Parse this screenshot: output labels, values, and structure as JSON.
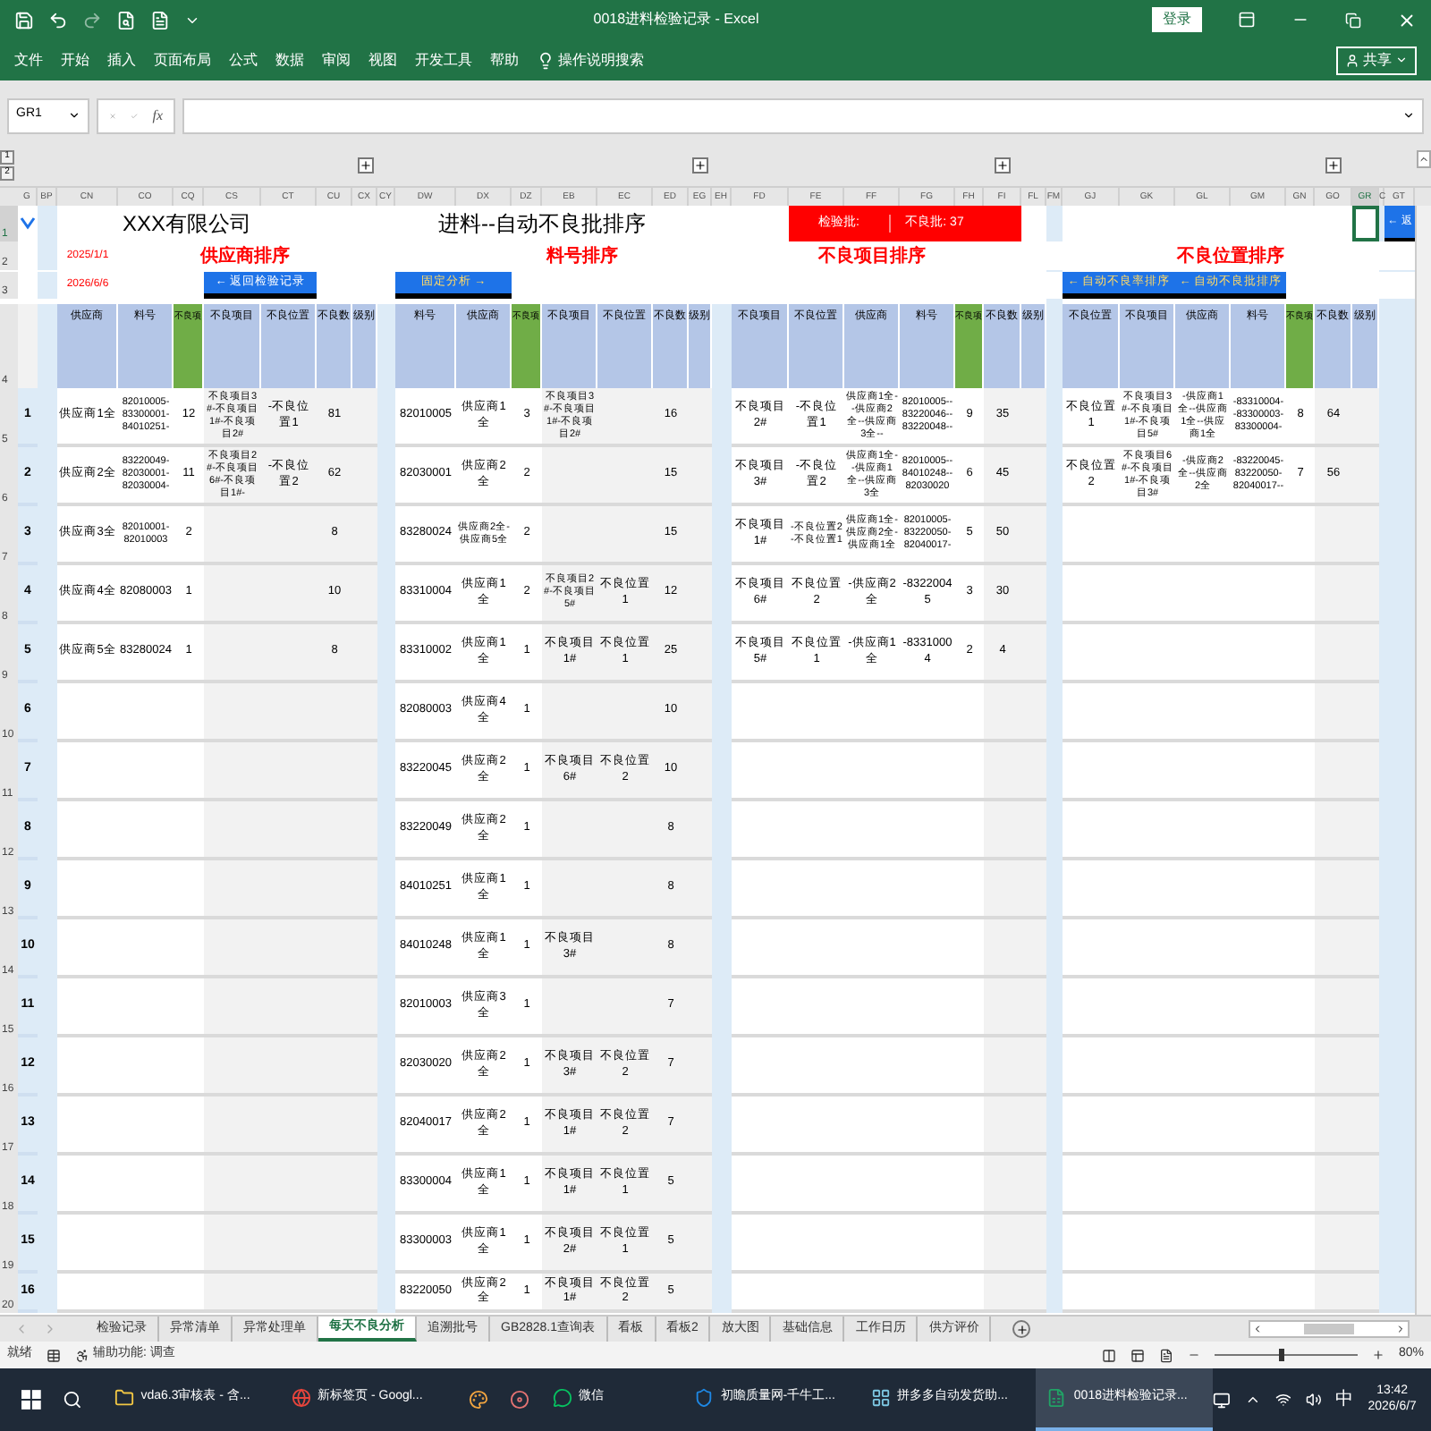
{
  "window": {
    "title": "0018进料检验记录 - Excel",
    "login_button": "登录"
  },
  "ribbon_tabs": [
    "文件",
    "开始",
    "插入",
    "页面布局",
    "公式",
    "数据",
    "审阅",
    "视图",
    "开发工具",
    "帮助"
  ],
  "tell_me": "操作说明搜索",
  "share_button": "共享",
  "name_box": "GR1",
  "function_label": "fx",
  "outline_levels": [
    "1",
    "2"
  ],
  "column_headers": [
    {
      "label": "G",
      "selected": false
    },
    {
      "label": "BP",
      "selected": false
    },
    {
      "label": "CN",
      "selected": false
    },
    {
      "label": "CO",
      "selected": false
    },
    {
      "label": "CQ",
      "selected": false
    },
    {
      "label": "CS",
      "selected": false
    },
    {
      "label": "CT",
      "selected": false
    },
    {
      "label": "CU",
      "selected": false
    },
    {
      "label": "CX",
      "selected": false
    },
    {
      "label": "CY",
      "selected": false
    },
    {
      "label": "DW",
      "selected": false
    },
    {
      "label": "DX",
      "selected": false
    },
    {
      "label": "DZ",
      "selected": false
    },
    {
      "label": "EB",
      "selected": false
    },
    {
      "label": "EC",
      "selected": false
    },
    {
      "label": "ED",
      "selected": false
    },
    {
      "label": "EG",
      "selected": false
    },
    {
      "label": "EH",
      "selected": false
    },
    {
      "label": "FD",
      "selected": false
    },
    {
      "label": "FE",
      "selected": false
    },
    {
      "label": "FF",
      "selected": false
    },
    {
      "label": "FG",
      "selected": false
    },
    {
      "label": "FH",
      "selected": false
    },
    {
      "label": "FI",
      "selected": false
    },
    {
      "label": "FL",
      "selected": false
    },
    {
      "label": "FM",
      "selected": false
    },
    {
      "label": "GJ",
      "selected": false
    },
    {
      "label": "GK",
      "selected": false
    },
    {
      "label": "GL",
      "selected": false
    },
    {
      "label": "GM",
      "selected": false
    },
    {
      "label": "GN",
      "selected": false
    },
    {
      "label": "GO",
      "selected": false
    },
    {
      "label": "GR",
      "selected": true
    },
    {
      "label": "C",
      "selected": false
    },
    {
      "label": "GT",
      "selected": false
    }
  ],
  "row_headers": [
    {
      "label": "1",
      "selected": true
    },
    {
      "label": "2",
      "selected": false
    },
    {
      "label": "3",
      "selected": false
    },
    {
      "label": "4",
      "selected": false
    },
    {
      "label": "5",
      "selected": false
    },
    {
      "label": "6",
      "selected": false
    },
    {
      "label": "7",
      "selected": false
    },
    {
      "label": "8",
      "selected": false
    },
    {
      "label": "9",
      "selected": false
    },
    {
      "label": "10",
      "selected": false
    },
    {
      "label": "11",
      "selected": false
    },
    {
      "label": "12",
      "selected": false
    },
    {
      "label": "13",
      "selected": false
    },
    {
      "label": "14",
      "selected": false
    },
    {
      "label": "15",
      "selected": false
    },
    {
      "label": "16",
      "selected": false
    },
    {
      "label": "17",
      "selected": false
    },
    {
      "label": "18",
      "selected": false
    },
    {
      "label": "19",
      "selected": false
    },
    {
      "label": "20",
      "selected": false
    }
  ],
  "outline_numbers": [
    "1",
    "2",
    "3",
    "4",
    "5",
    "6",
    "7",
    "8",
    "9",
    "10",
    "11",
    "12",
    "13",
    "14",
    "15",
    "16"
  ],
  "sheet": {
    "company": "XXX有限公司",
    "report_title": "进料--自动不良批排序",
    "banner_label": "检验批:",
    "banner_count": "不良批: 37",
    "date_from": "2025/1/1",
    "date_to": "2026/6/6",
    "edge_button": "← 返",
    "sections": [
      {
        "title": "供应商排序",
        "buttons": [
          "← 返回检验记录"
        ],
        "headers": [
          "供应商",
          "料号",
          "不良项",
          "不良项目",
          "不良位置",
          "不良数",
          "级别"
        ],
        "rows": [
          [
            "供应商1全",
            "82010005-83300001-84010251-",
            "12",
            "不良项目3#-不良项目1#-不良项目2#",
            "-不良位置1",
            "81",
            ""
          ],
          [
            "供应商2全",
            "83220049-82030001-82030004-",
            "11",
            "不良项目2#-不良项目6#-不良项目1#-",
            "-不良位置2",
            "62",
            ""
          ],
          [
            "供应商3全",
            "82010001-82010003",
            "2",
            "",
            "",
            "8",
            ""
          ],
          [
            "供应商4全",
            "82080003",
            "1",
            "",
            "",
            "10",
            ""
          ],
          [
            "供应商5全",
            "83280024",
            "1",
            "",
            "",
            "8",
            ""
          ]
        ]
      },
      {
        "title": "料号排序",
        "buttons": [
          "固定分析 →"
        ],
        "headers": [
          "料号",
          "供应商",
          "不良项",
          "不良项目",
          "不良位置",
          "不良数",
          "级别"
        ],
        "rows": [
          [
            "82010005",
            "供应商1全",
            "3",
            "不良项目3#-不良项目1#-不良项目2#",
            "",
            "16",
            ""
          ],
          [
            "82030001",
            "供应商2全",
            "2",
            "",
            "",
            "15",
            ""
          ],
          [
            "83280024",
            "供应商2全-供应商5全",
            "2",
            "",
            "",
            "15",
            ""
          ],
          [
            "83310004",
            "供应商1全",
            "2",
            "不良项目2#-不良项目5#",
            "不良位置1",
            "12",
            ""
          ],
          [
            "83310002",
            "供应商1全",
            "1",
            "不良项目1#",
            "不良位置1",
            "25",
            ""
          ],
          [
            "82080003",
            "供应商4全",
            "1",
            "",
            "",
            "10",
            ""
          ],
          [
            "83220045",
            "供应商2全",
            "1",
            "不良项目6#",
            "不良位置2",
            "10",
            ""
          ],
          [
            "83220049",
            "供应商2全",
            "1",
            "",
            "",
            "8",
            ""
          ],
          [
            "84010251",
            "供应商1全",
            "1",
            "",
            "",
            "8",
            ""
          ],
          [
            "84010248",
            "供应商1全",
            "1",
            "不良项目3#",
            "",
            "8",
            ""
          ],
          [
            "82010003",
            "供应商3全",
            "1",
            "",
            "",
            "7",
            ""
          ],
          [
            "82030020",
            "供应商2全",
            "1",
            "不良项目3#",
            "不良位置2",
            "7",
            ""
          ],
          [
            "82040017",
            "供应商2全",
            "1",
            "不良项目1#",
            "不良位置2",
            "7",
            ""
          ],
          [
            "83300004",
            "供应商1全",
            "1",
            "不良项目1#",
            "不良位置1",
            "5",
            ""
          ],
          [
            "83300003",
            "供应商1全",
            "1",
            "不良项目2#",
            "不良位置1",
            "5",
            ""
          ],
          [
            "83220050",
            "供应商2全",
            "1",
            "不良项目1#",
            "不良位置2",
            "5",
            ""
          ]
        ]
      },
      {
        "title": "不良项目排序",
        "headers": [
          "不良项目",
          "不良位置",
          "供应商",
          "料号",
          "不良项",
          "不良数",
          "级别"
        ],
        "rows": [
          [
            "不良项目2#",
            "-不良位置1",
            "供应商1全--供应商2全--供应商3全--",
            "82010005--83220046--83220048--",
            "9",
            "35",
            ""
          ],
          [
            "不良项目3#",
            "-不良位置2",
            "供应商1全--供应商1全--供应商3全",
            "82010005--84010248--82030020",
            "6",
            "45",
            ""
          ],
          [
            "不良项目1#",
            "-不良位置2-不良位置1",
            "供应商1全-供应商2全-供应商1全",
            "82010005-83220050-82040017-",
            "5",
            "50",
            ""
          ],
          [
            "不良项目6#",
            "不良位置2",
            "-供应商2全",
            "-83220045",
            "3",
            "30",
            ""
          ],
          [
            "不良项目5#",
            "不良位置1",
            "-供应商1全",
            "-83310004",
            "2",
            "4",
            ""
          ]
        ]
      },
      {
        "title": "不良位置排序",
        "buttons": [
          "← 自动不良率排序",
          "← 自动不良批排序"
        ],
        "headers": [
          "不良位置",
          "不良项目",
          "供应商",
          "料号",
          "不良项",
          "不良数",
          "级别"
        ],
        "rows": [
          [
            "不良位置1",
            "不良项目3#-不良项目1#-不良项目5#",
            "-供应商1全--供应商1全--供应商1全",
            "-83310004--83300003-83300004-",
            "8",
            "64",
            ""
          ],
          [
            "不良位置2",
            "不良项目6#-不良项目1#-不良项目3#",
            "-供应商2全--供应商2全",
            "-83220045-83220050-82040017--",
            "7",
            "56",
            ""
          ]
        ]
      }
    ]
  },
  "sheet_tabs": [
    {
      "label": "检验记录",
      "selected": false
    },
    {
      "label": "异常清单",
      "selected": false
    },
    {
      "label": "异常处理单",
      "selected": false
    },
    {
      "label": "每天不良分析",
      "selected": true
    },
    {
      "label": "追溯批号",
      "selected": false
    },
    {
      "label": "GB2828.1查询表",
      "selected": false
    },
    {
      "label": "看板",
      "selected": false
    },
    {
      "label": "看板2",
      "selected": false
    },
    {
      "label": "放大图",
      "selected": false
    },
    {
      "label": "基础信息",
      "selected": false
    },
    {
      "label": "工作日历",
      "selected": false
    },
    {
      "label": "供方评价",
      "selected": false
    }
  ],
  "status": {
    "ready": "就绪",
    "accessibility": "辅助功能: 调查",
    "zoom": "80%",
    "zoom_slider": {
      "level": 0.45
    }
  },
  "taskbar": {
    "apps": [
      {
        "label": "vda6.3审核表 - 含...",
        "active": false
      },
      {
        "label": "新标签页 - Googl...",
        "active": false
      },
      {
        "label": "微信",
        "active": false
      },
      {
        "label": "初瞻质量网-千牛工...",
        "active": false
      },
      {
        "label": "拼多多自动发货助...",
        "active": false
      },
      {
        "label": "0018进料检验记录...",
        "active": true
      }
    ],
    "ime": "中",
    "time": "13:42",
    "date": "2026/6/7"
  }
}
